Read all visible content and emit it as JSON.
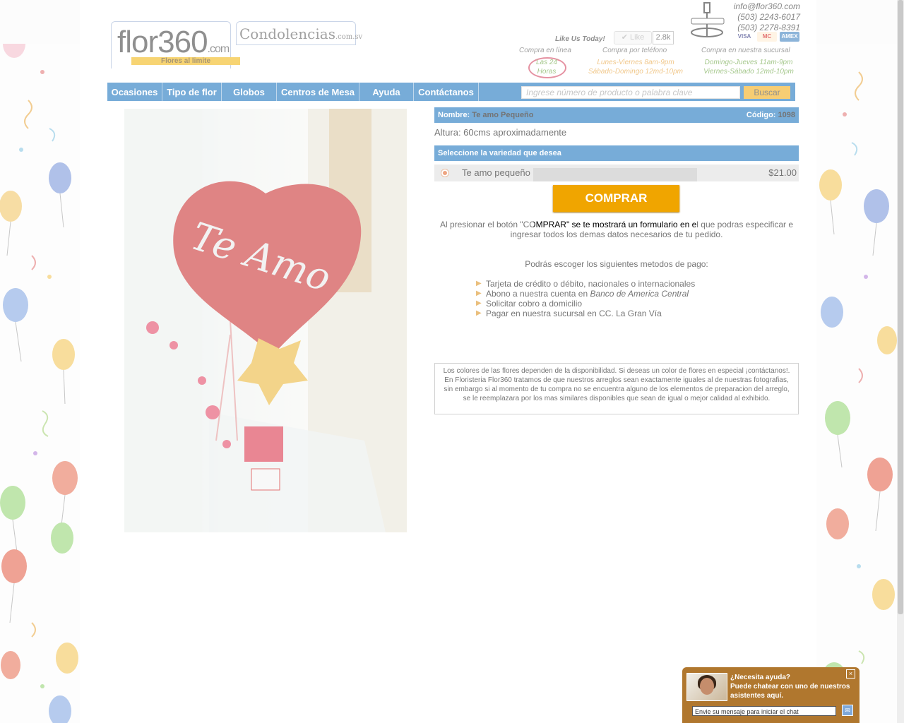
{
  "header": {
    "logo_text": "flor360",
    "logo_domain": ".com",
    "logo_tagline": "Flores al limite",
    "logo2_text": "Condolencias",
    "logo2_domain": ".com.sv",
    "like_label": "Like Us Today!",
    "like_button": "Like",
    "like_count": "2.8k",
    "email": "info@flor360.com",
    "phone1": "(503) 2243-6017",
    "phone2": "(503) 2278-8391",
    "cards": [
      "VISA",
      "MC",
      "AMEX"
    ]
  },
  "info": {
    "online_head": "Compra en línea",
    "online_val1": "Las 24",
    "online_val2": "Horas",
    "phone_head": "Compra por teléfono",
    "phone_val1": "Lunes-Viernes 8am-9pm",
    "phone_val2": "Sábado-Domingo 12md-10pm",
    "store_head": "Compra en nuestra sucursal",
    "store_val1": "Domingo-Jueves 11am-9pm",
    "store_val2": "Viernes-Sábado 12md-10pm"
  },
  "nav": {
    "items": [
      "Ocasiones",
      "Tipo de flor",
      "Globos",
      "Centros de Mesa",
      "Ayuda",
      "Contáctanos"
    ],
    "search_placeholder": "Ingrese número de producto o palabra clave",
    "search_button": "Buscar"
  },
  "product": {
    "name_label": "Nombre:",
    "name": "Te amo Pequeño",
    "code_label": "Código:",
    "code": "1098",
    "height": "Altura: 60cms aproximadamente",
    "variety_header": "Seleccione la variedad que desea",
    "variety_name": "Te amo pequeño",
    "variety_price": "$21.00",
    "buy_button": "COMPRAR",
    "buy_note": "Al presionar el botón \"COMPRAR\" se te mostrará un formulario en el que podras especificar e ingresar todos los demas datos necesarios de tu pedido.",
    "payment_title": "Podrás escoger los siguientes metodos de pago:",
    "payment_1": "Tarjeta de crédito o débito, nacionales o internacionales",
    "payment_2_prefix": "Abono a nuestra cuenta en ",
    "payment_2_bank": "Banco de America Central",
    "payment_3": "Solicitar cobro a domicilio",
    "payment_4": "Pagar en nuestra sucursal en CC. La Gran Vía",
    "disclaimer": "Los colores de las flores dependen de la disponibilidad. Si deseas un color de flores en especial ¡contáctanos!. En Floristeria Flor360 tratamos de que nuestros arreglos sean exactamente iguales al de nuestras fotografias, sin embargo si al momento de tu compra no se encuentra alguno de los elementos de preparacion del arreglo, se le reemplazara por los mas similares disponibles que sean de igual o mejor calidad al exhibido.",
    "balloon_text": "Te Amo"
  },
  "chat": {
    "title": "¿Necesita ayuda?",
    "subtitle": "Puede chatear con uno de nuestros asistentes aquí.",
    "input_placeholder": "Envie su mensaje para iniciar el chat",
    "close": "×"
  },
  "colors": {
    "nav_blue": "#0968b8",
    "accent_orange": "#f0a500",
    "chat_brown": "#b0772e"
  }
}
